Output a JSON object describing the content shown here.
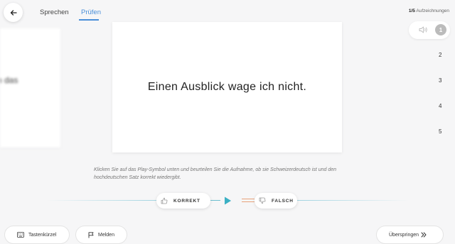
{
  "header": {
    "tabs": [
      {
        "label": "Sprechen",
        "active": false
      },
      {
        "label": "Prüfen",
        "active": true
      }
    ],
    "counter": {
      "current": "1/5",
      "label": "Aufzeichnungen"
    }
  },
  "left_card": {
    "text": "n das"
  },
  "card": {
    "sentence": "Einen Ausblick wage ich nicht."
  },
  "queue": [
    "1",
    "2",
    "3",
    "4",
    "5"
  ],
  "instructions": "Klicken Sie auf das Play-Symbol unten und beurteilen Sie die Aufnahme, ob sie Schweizerdeutsch ist und den hochdeutschen Satz korrekt wiedergibt.",
  "controls": {
    "correct_label": "KORREKT",
    "wrong_label": "FALSCH"
  },
  "footer": {
    "shortcuts_label": "Tastenkürzel",
    "report_label": "Melden",
    "skip_label": "Überspringen"
  },
  "colors": {
    "accent": "#4a8fd8",
    "play": "#3bb0c4",
    "wrong_line": "#e8a27a"
  }
}
